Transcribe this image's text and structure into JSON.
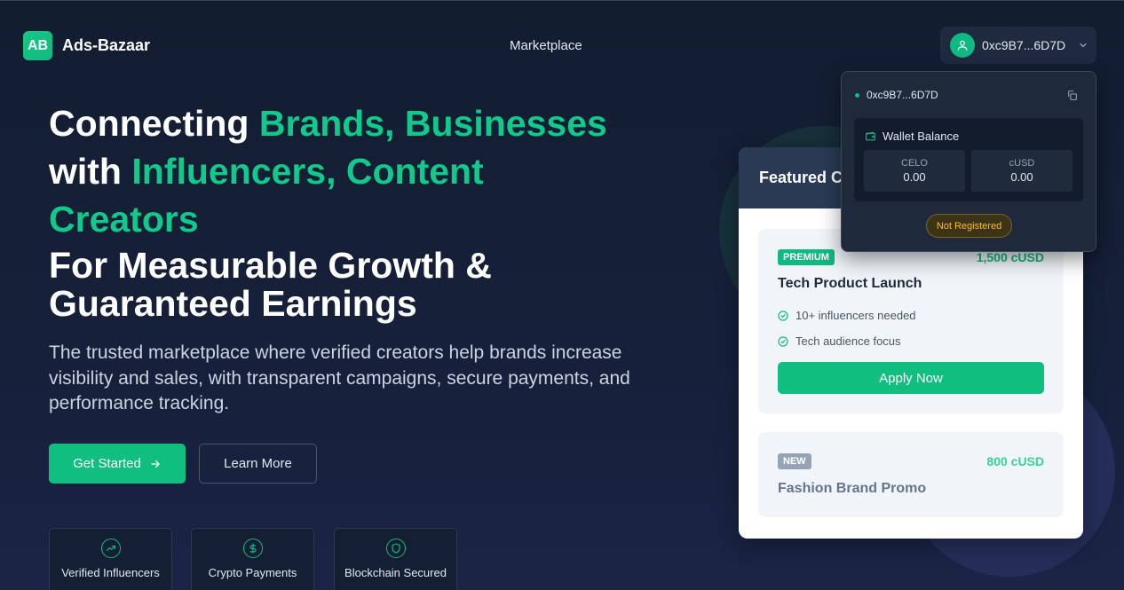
{
  "header": {
    "logo_initials": "AB",
    "brand": "Ads-Bazaar",
    "nav_marketplace": "Marketplace",
    "wallet_address": "0xc9B7...6D7D"
  },
  "hero": {
    "line1_white": "Connecting ",
    "line1_green": "Brands, Businesses",
    "line2_white": "with ",
    "line2_green": "Influencers, Content",
    "line3_green": "Creators",
    "subheading_line1": "For Measurable Growth &",
    "subheading_line2": "Guaranteed Earnings",
    "description": "The trusted marketplace where verified creators help brands increase visibility and sales, with transparent campaigns, secure payments, and performance tracking.",
    "cta_primary": "Get Started",
    "cta_secondary": "Learn More"
  },
  "features": [
    {
      "label": "Verified Influencers",
      "icon": "trending-up-icon"
    },
    {
      "label": "Crypto Payments",
      "icon": "dollar-icon"
    },
    {
      "label": "Blockchain Secured",
      "icon": "shield-icon"
    }
  ],
  "featured": {
    "title": "Featured Campaigns",
    "campaigns": [
      {
        "tag": "PREMIUM",
        "price": "1,500 cUSD",
        "title": "Tech Product Launch",
        "requirements": [
          "10+ influencers needed",
          "Tech audience focus"
        ],
        "cta": "Apply Now"
      },
      {
        "tag": "NEW",
        "price": "800 cUSD",
        "title": "Fashion Brand Promo"
      }
    ]
  },
  "wallet_dropdown": {
    "address": "0xc9B7...6D7D",
    "balance_title": "Wallet Balance",
    "tokens": [
      {
        "name": "CELO",
        "value": "0.00"
      },
      {
        "name": "cUSD",
        "value": "0.00"
      }
    ],
    "status": "Not Registered"
  },
  "colors": {
    "accent": "#10b981",
    "background": "#131d30",
    "warning": "#fbbf24"
  }
}
